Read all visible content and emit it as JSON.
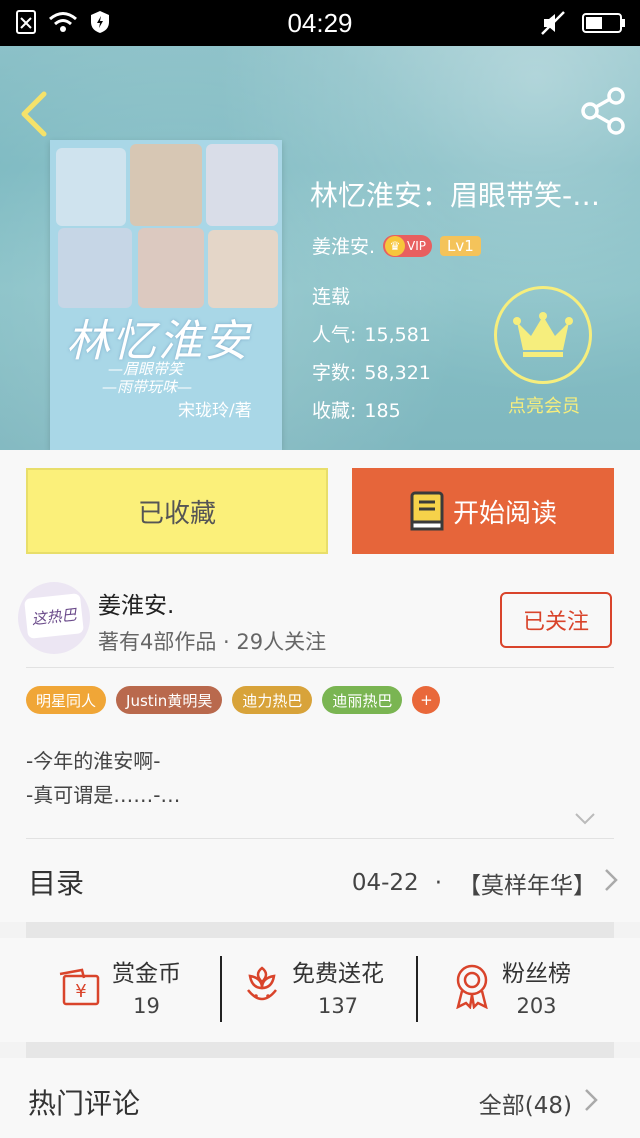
{
  "status_bar": {
    "time": "04:29"
  },
  "book": {
    "title": "林忆淮安：眉眼带笑-…",
    "author": "姜淮安.",
    "vip_label": "VIP",
    "level": "Lv1",
    "status": "连载",
    "stats": [
      {
        "label": "人气:",
        "value": "15,581"
      },
      {
        "label": "字数:",
        "value": "58,321"
      },
      {
        "label": "收藏:",
        "value": "185"
      }
    ],
    "member_label": "点亮会员",
    "cover": {
      "title": "林忆淮安",
      "sub1": "—眉眼带笑",
      "sub2": "—雨带玩味—",
      "author": "宋珑玲/著"
    }
  },
  "actions": {
    "favorite_label": "已收藏",
    "read_label": "开始阅读"
  },
  "author_card": {
    "name": "姜淮安.",
    "meta": "著有4部作品 · 29人关注",
    "follow_label": "已关注",
    "avatar_text": "这热巴"
  },
  "tags": [
    {
      "label": "明星同人",
      "color": "#f0a637"
    },
    {
      "label": "Justin黄明昊",
      "color": "#b9694d"
    },
    {
      "label": "迪力热巴",
      "color": "#d8a33a"
    },
    {
      "label": "迪丽热巴",
      "color": "#7ab552"
    },
    {
      "label": "+",
      "color": "#e9683a"
    }
  ],
  "description": {
    "line1": "-今年的淮安啊-",
    "line2": "-真可谓是……-…"
  },
  "catalog": {
    "label": "目录",
    "date": "04-22",
    "sep": "·",
    "latest": "【莫样年华】"
  },
  "rewards": [
    {
      "title": "赏金币",
      "num": "19"
    },
    {
      "title": "免费送花",
      "num": "137"
    },
    {
      "title": "粉丝榜",
      "num": "203"
    }
  ],
  "comments": {
    "label": "热门评论",
    "all_label": "全部(48)"
  },
  "colors": {
    "accent_orange": "#e6653a",
    "accent_yellow": "#fbf07a",
    "follow_red": "#d9442b",
    "icon_red": "#d9442b"
  }
}
